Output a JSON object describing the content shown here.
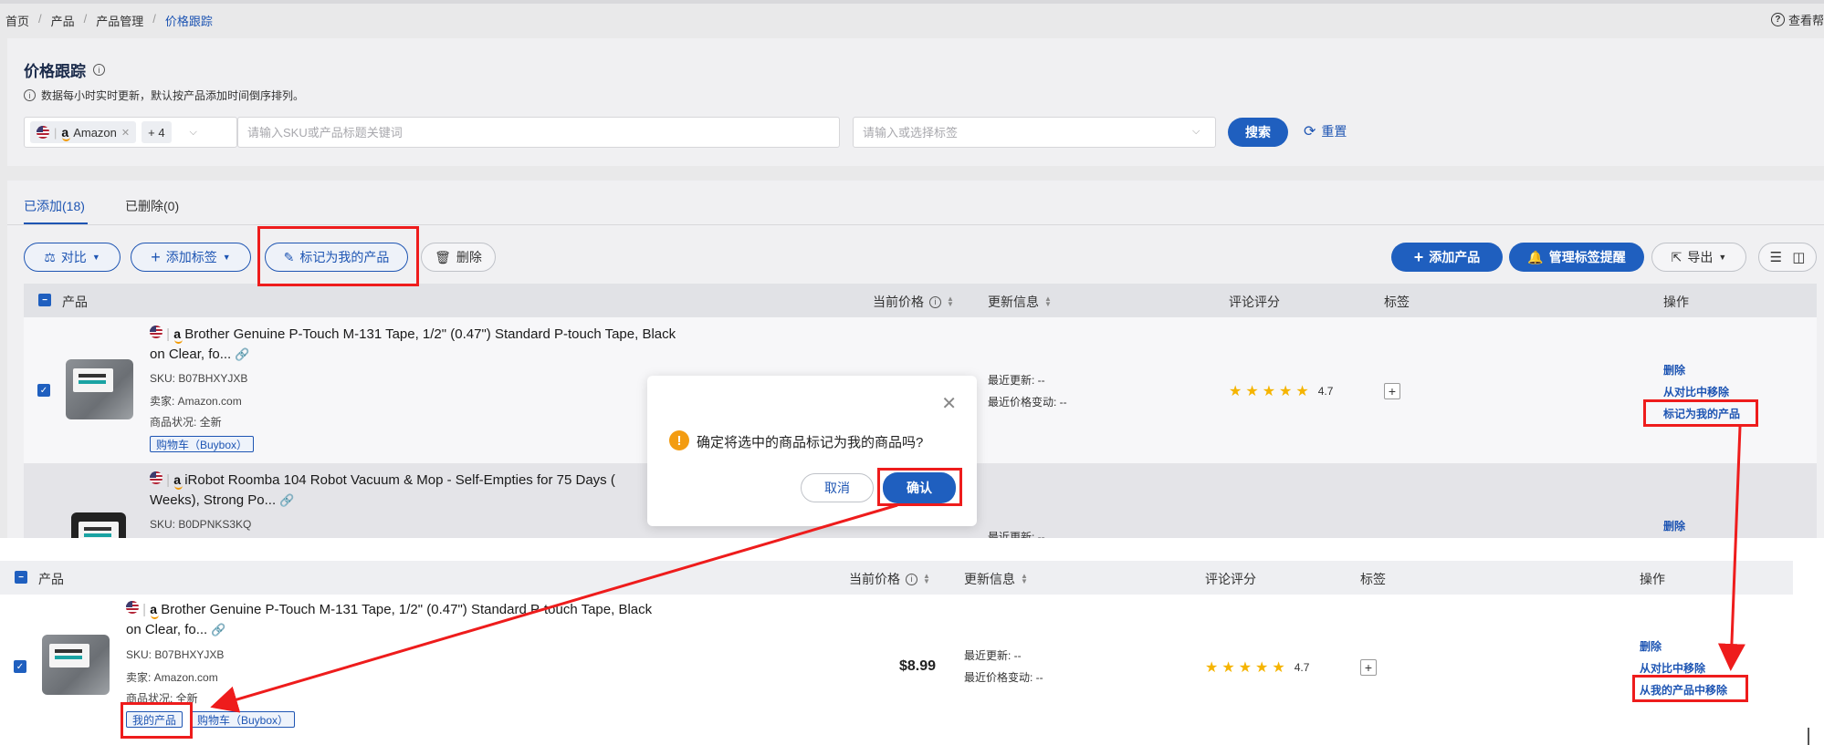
{
  "breadcrumb": {
    "home": "首页",
    "products": "产品",
    "manage": "产品管理",
    "current": "价格跟踪"
  },
  "help_link": "查看帮",
  "page": {
    "title": "价格跟踪",
    "tip": "数据每小时实时更新，默认按产品添加时间倒序排列。"
  },
  "filters": {
    "marketplace": "Amazon",
    "more_count": "+ 4",
    "sku_placeholder": "请输入SKU或产品标题关键词",
    "tag_placeholder": "请输入或选择标签",
    "search_label": "搜索",
    "reset_label": "重置"
  },
  "tabs": {
    "added": "已添加(18)",
    "deleted": "已删除(0)"
  },
  "toolbar": {
    "compare": "对比",
    "add_tag": "添加标签",
    "mark_mine": "标记为我的产品",
    "delete": "删除",
    "add_product": "添加产品",
    "manage_alerts": "管理标签提醒",
    "export": "导出"
  },
  "table_headers": {
    "product": "产品",
    "price": "当前价格",
    "update": "更新信息",
    "rating": "评论评分",
    "tags": "标签",
    "ops": "操作"
  },
  "rows": [
    {
      "title_line1": "Brother Genuine P-Touch M-131 Tape, 1/2\" (0.47\") Standard P-touch Tape, Black",
      "title_line2": "on Clear, fo...",
      "sku": "SKU: B07BHXYJXB",
      "seller": "卖家: Amazon.com",
      "condition": "商品状况: 全新",
      "buybox": "购物车（Buybox）",
      "last_update": "最近更新: --",
      "price_change": "最近价格变动: --",
      "rating": "4.7",
      "ops": {
        "delete": "删除",
        "remove_compare": "从对比中移除",
        "mark_mine": "标记为我的产品"
      }
    },
    {
      "title_line1": "iRobot Roomba 104 Robot Vacuum & Mop - Self-Empties for 75 Days (",
      "title_line2": "Weeks), Strong Po...",
      "sku": "SKU: B0DPNKS3KQ",
      "last_update": "最近更新: --",
      "ops": {
        "delete": "删除"
      }
    }
  ],
  "dialog": {
    "message": "确定将选中的商品标记为我的商品吗?",
    "cancel": "取消",
    "confirm": "确认"
  },
  "result_row": {
    "title_line1": "Brother Genuine P-Touch M-131 Tape, 1/2\" (0.47\") Standard P-touch Tape, Black",
    "title_line2": "on Clear, fo...",
    "sku": "SKU: B07BHXYJXB",
    "seller": "卖家: Amazon.com",
    "condition": "商品状况: 全新",
    "my_product": "我的产品",
    "buybox": "购物车（Buybox）",
    "price": "$8.99",
    "last_update": "最近更新: --",
    "price_change": "最近价格变动: --",
    "rating": "4.7",
    "ops": {
      "delete": "删除",
      "remove_compare": "从对比中移除",
      "remove_mine": "从我的产品中移除"
    }
  },
  "colors": {
    "primary": "#1f5fbf",
    "annotation": "#ee1c1c",
    "star": "#f5b400",
    "warning": "#f39c12"
  }
}
